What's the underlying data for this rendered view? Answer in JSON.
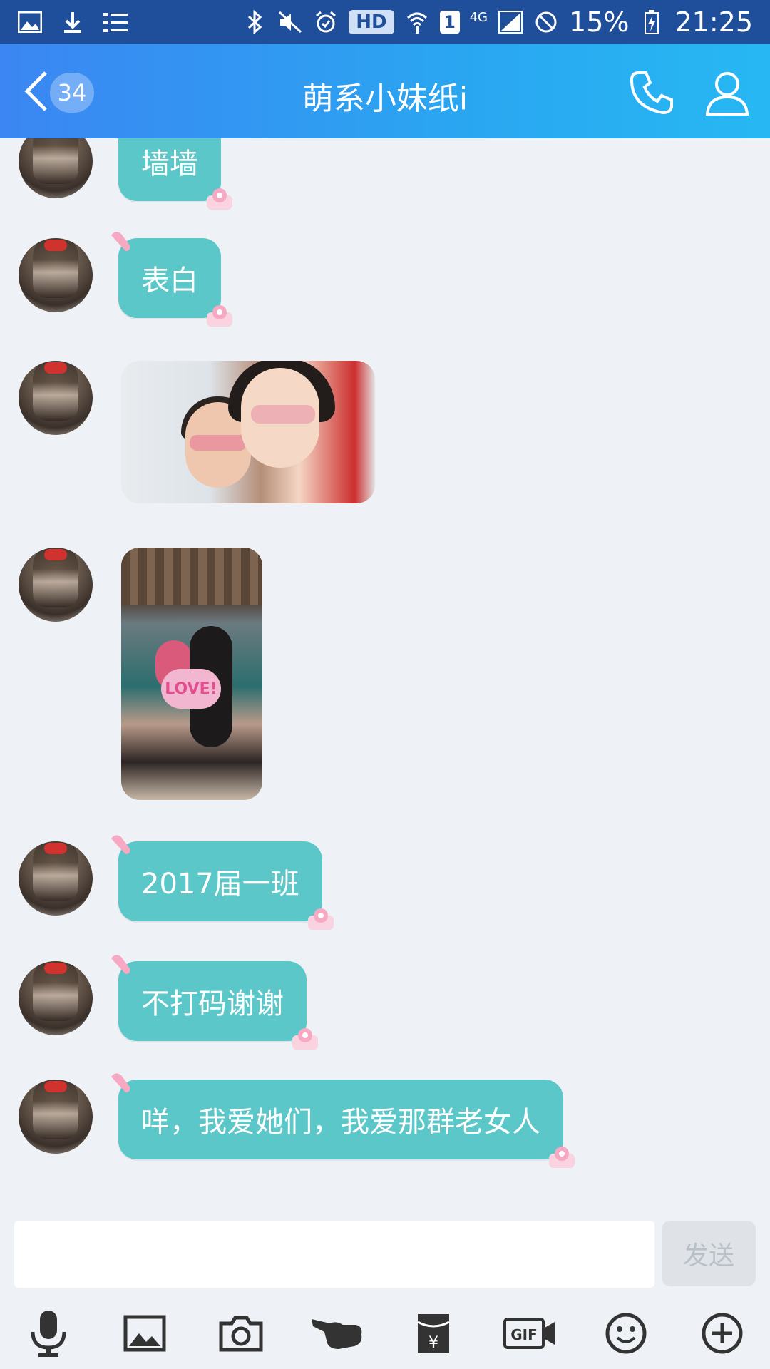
{
  "status_bar": {
    "hd": "HD",
    "sim": "1",
    "network": "4G",
    "battery": "15%",
    "time": "21:25"
  },
  "header": {
    "unread_count": "34",
    "title": "萌系小妹纸i"
  },
  "messages": [
    {
      "type": "text",
      "text": "墙墙"
    },
    {
      "type": "text",
      "text": "表白"
    },
    {
      "type": "image",
      "text": ""
    },
    {
      "type": "image",
      "text": "LOVE!"
    },
    {
      "type": "text",
      "text": "2017届一班"
    },
    {
      "type": "text",
      "text": "不打码谢谢"
    },
    {
      "type": "text",
      "text": "咩，我爱她们，我爱那群老女人"
    }
  ],
  "input": {
    "placeholder": "",
    "send_label": "发送"
  },
  "toolbar": {
    "items": [
      "microphone-icon",
      "image-icon",
      "camera-icon",
      "poke-icon",
      "red-packet-icon",
      "gif-icon",
      "emoji-icon",
      "plus-icon"
    ]
  },
  "colors": {
    "header_start": "#3b86f2",
    "header_end": "#27b8f3",
    "bubble": "#5bc7c8",
    "status_bar": "#1f4f9a",
    "background": "#eef2f6"
  }
}
